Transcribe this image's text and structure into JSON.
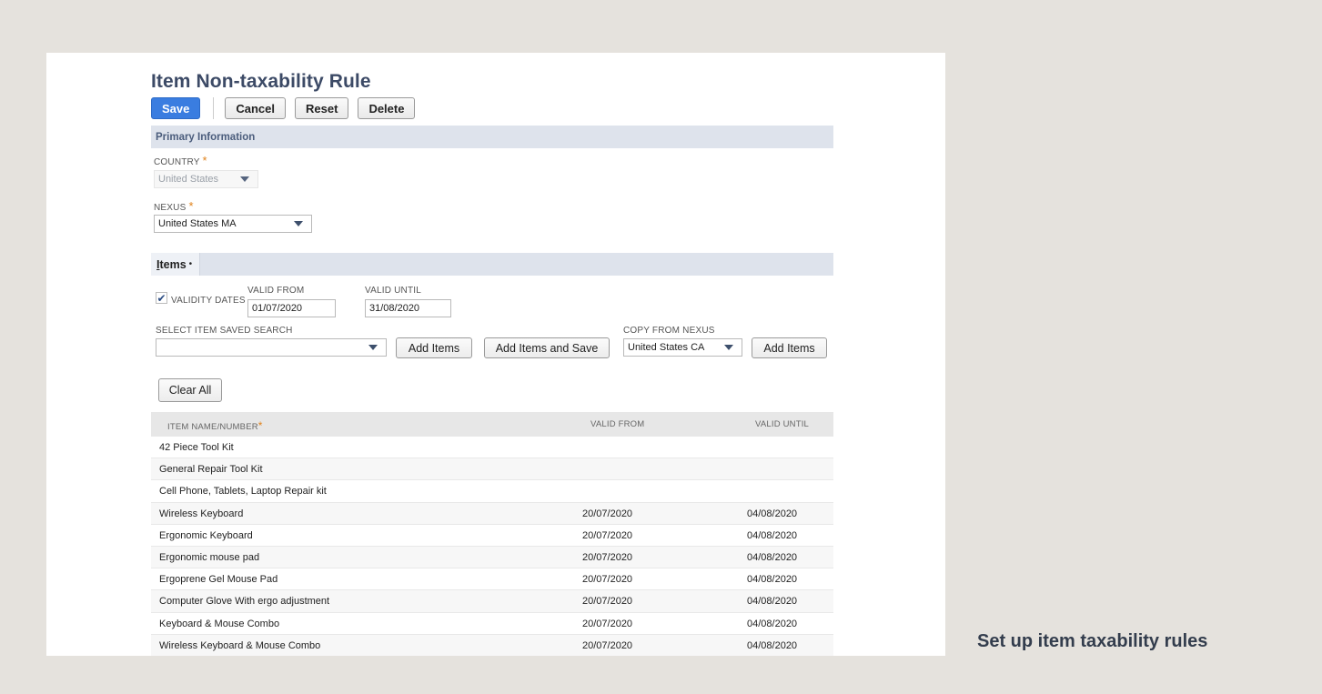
{
  "page": {
    "title": "Item Non-taxability Rule"
  },
  "toolbar": {
    "save": "Save",
    "cancel": "Cancel",
    "reset": "Reset",
    "delete": "Delete"
  },
  "primary": {
    "header": "Primary Information",
    "country_label": "COUNTRY",
    "country_value": "United States",
    "nexus_label": "NEXUS",
    "nexus_value": "United States MA",
    "required_mark": "*"
  },
  "items_section": {
    "tab_label_accel": "I",
    "tab_label_rest": "tems",
    "tab_dot": "•",
    "validity_label": "VALIDITY DATES",
    "validity_checked": true,
    "check_glyph": "✔",
    "valid_from_label": "VALID FROM",
    "valid_from_value": "01/07/2020",
    "valid_until_label": "VALID UNTIL",
    "valid_until_value": "31/08/2020",
    "saved_search_label": "SELECT ITEM SAVED SEARCH",
    "saved_search_value": "",
    "add_items": "Add Items",
    "add_items_and_save": "Add Items and Save",
    "copy_label": "COPY FROM NEXUS",
    "copy_value": "United States CA",
    "copy_add_items": "Add Items",
    "clear_all": "Clear All"
  },
  "table": {
    "headers": {
      "name": "ITEM NAME/NUMBER",
      "valid_from": "VALID FROM",
      "valid_until": "VALID UNTIL"
    },
    "rows": [
      {
        "name": "42 Piece Tool Kit",
        "from": "",
        "until": ""
      },
      {
        "name": "General Repair Tool Kit",
        "from": "",
        "until": ""
      },
      {
        "name": "Cell Phone, Tablets, Laptop Repair kit",
        "from": "",
        "until": ""
      },
      {
        "name": "Wireless Keyboard",
        "from": "20/07/2020",
        "until": "04/08/2020"
      },
      {
        "name": "Ergonomic Keyboard",
        "from": "20/07/2020",
        "until": "04/08/2020"
      },
      {
        "name": "Ergonomic mouse pad",
        "from": "20/07/2020",
        "until": "04/08/2020"
      },
      {
        "name": "Ergoprene Gel Mouse Pad",
        "from": "20/07/2020",
        "until": "04/08/2020"
      },
      {
        "name": "Computer Glove With ergo adjustment",
        "from": "20/07/2020",
        "until": "04/08/2020"
      },
      {
        "name": "Keyboard & Mouse Combo",
        "from": "20/07/2020",
        "until": "04/08/2020"
      },
      {
        "name": "Wireless Keyboard & Mouse Combo",
        "from": "20/07/2020",
        "until": "04/08/2020"
      }
    ]
  },
  "caption": "Set up item taxability rules",
  "colors": {
    "accent": "#3a7de0",
    "title": "#3c4a66",
    "section_bar": "#dee3ec",
    "required": "#e0821b"
  }
}
